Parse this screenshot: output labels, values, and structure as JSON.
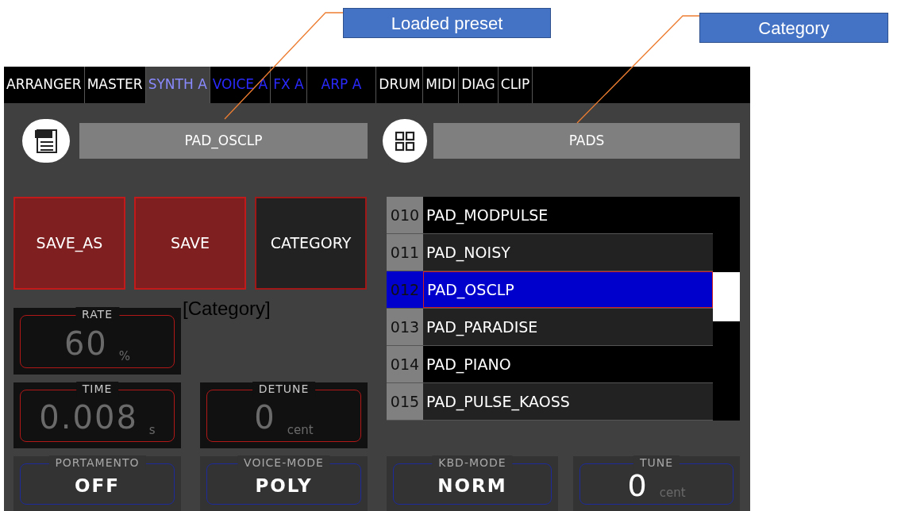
{
  "annotations": [
    {
      "label": "Loaded preset"
    },
    {
      "label": "Category"
    }
  ],
  "tabs": [
    {
      "label": "ARRANGER",
      "selected": false,
      "kind": "global"
    },
    {
      "label": "MASTER",
      "selected": false,
      "kind": "global"
    },
    {
      "label": "SYNTH A",
      "selected": true,
      "kind": "part"
    },
    {
      "label": "VOICE A",
      "selected": false,
      "kind": "part"
    },
    {
      "label": "FX A",
      "selected": false,
      "kind": "part"
    },
    {
      "label": "ARP A",
      "selected": false,
      "kind": "part"
    },
    {
      "label": "DRUM",
      "selected": false,
      "kind": "global"
    },
    {
      "label": "MIDI",
      "selected": false,
      "kind": "global"
    },
    {
      "label": "DIAG",
      "selected": false,
      "kind": "global"
    },
    {
      "label": "CLIP",
      "selected": false,
      "kind": "global"
    }
  ],
  "preset": {
    "value": "PAD_OSCLP"
  },
  "category": {
    "value": "PADS"
  },
  "buttons": [
    {
      "label": "SAVE_AS",
      "kind": "danger"
    },
    {
      "label": "SAVE",
      "kind": "danger"
    },
    {
      "label": "CATEGORY",
      "kind": "normal"
    }
  ],
  "category_note": "[Category]",
  "presets": [
    {
      "number": "010",
      "name": "PAD_MODPULSE",
      "selected": false
    },
    {
      "number": "011",
      "name": "PAD_NOISY",
      "selected": false
    },
    {
      "number": "012",
      "name": "PAD_OSCLP",
      "selected": true
    },
    {
      "number": "013",
      "name": "PAD_PARADISE",
      "selected": false
    },
    {
      "number": "014",
      "name": "PAD_PIANO",
      "selected": false
    },
    {
      "number": "015",
      "name": "PAD_PULSE_KAOSS",
      "selected": false
    }
  ],
  "controls": [
    {
      "label": "RATE",
      "value": "60",
      "unit": "%",
      "kind": "dial"
    },
    {
      "label": "TIME",
      "value": "0.008",
      "unit": "s",
      "kind": "dial"
    },
    {
      "label": "DETUNE",
      "value": "0",
      "unit": "cent",
      "kind": "dial"
    },
    {
      "label": "PORTAMENTO",
      "value": "OFF",
      "kind": "mode"
    },
    {
      "label": "VOICE-MODE",
      "value": "POLY",
      "kind": "mode"
    },
    {
      "label": "KBD-MODE",
      "value": "NORM",
      "kind": "mode"
    },
    {
      "label": "TUNE",
      "value": "0",
      "unit": "cent",
      "kind": "tuning"
    }
  ]
}
